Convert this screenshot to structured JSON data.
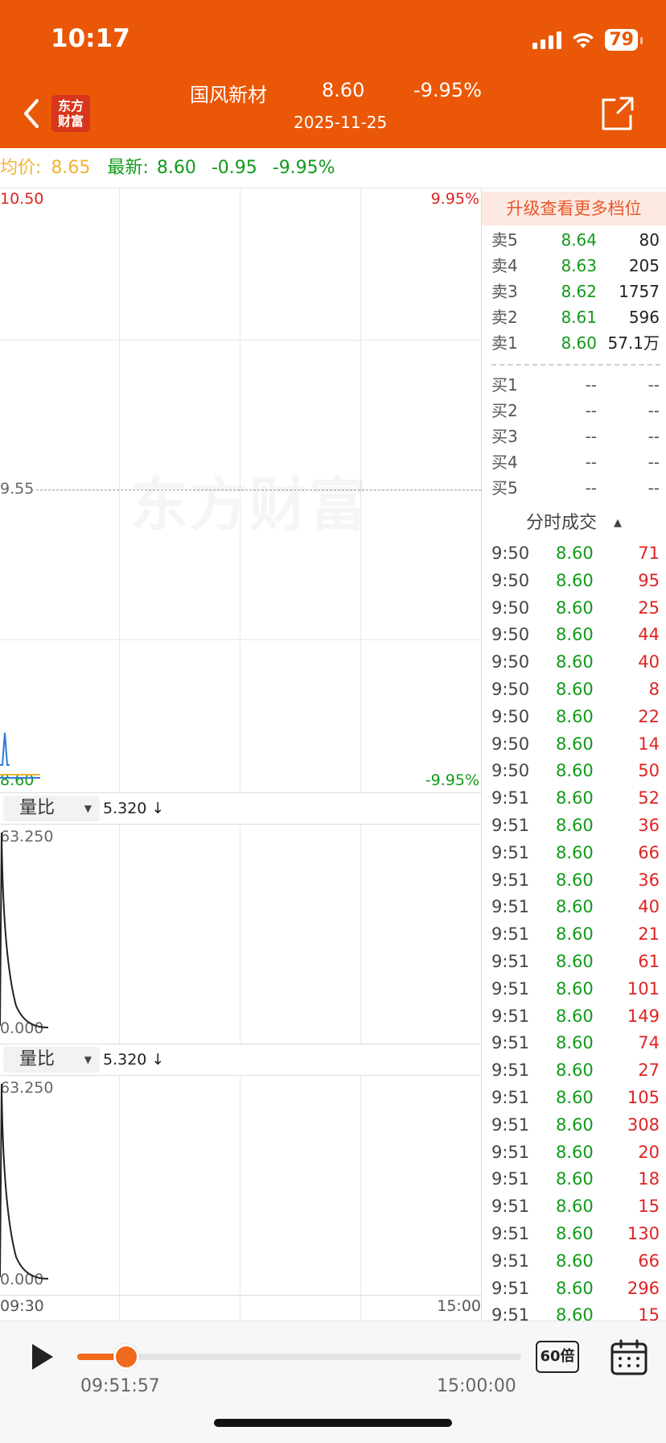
{
  "status_bar": {
    "time": "10:17",
    "battery": "79"
  },
  "header": {
    "logo_line1": "东方",
    "logo_line2": "财富",
    "stock_name": "国风新材",
    "price": "8.60",
    "change_pct": "-9.95%",
    "date": "2025-11-25"
  },
  "info_bar": {
    "avg_label": "均价:",
    "avg_value": "8.65",
    "latest_label": "最新:",
    "latest_value": "8.60",
    "change": "-0.95",
    "change_pct": "-9.95%"
  },
  "price_chart": {
    "top_price": "10.50",
    "top_pct": "9.95%",
    "mid_price": "9.55",
    "bottom_price": "8.60",
    "bottom_pct": "-9.95%",
    "watermark": "东方财富"
  },
  "indicator1": {
    "name": "量比",
    "value": "5.320 ↓",
    "max": "63.250",
    "min": "0.000"
  },
  "indicator2": {
    "name": "量比",
    "value": "5.320 ↓",
    "max": "63.250",
    "min": "0.000"
  },
  "time_axis": {
    "start": "09:30",
    "end": "15:00"
  },
  "order_book": {
    "upgrade_label": "升级查看更多档位",
    "asks": [
      {
        "label": "卖5",
        "price": "8.64",
        "volume": "80"
      },
      {
        "label": "卖4",
        "price": "8.63",
        "volume": "205"
      },
      {
        "label": "卖3",
        "price": "8.62",
        "volume": "1757"
      },
      {
        "label": "卖2",
        "price": "8.61",
        "volume": "596"
      },
      {
        "label": "卖1",
        "price": "8.60",
        "volume": "57.1万"
      }
    ],
    "bids": [
      {
        "label": "买1",
        "price": "--",
        "volume": "--"
      },
      {
        "label": "买2",
        "price": "--",
        "volume": "--"
      },
      {
        "label": "买3",
        "price": "--",
        "volume": "--"
      },
      {
        "label": "买4",
        "price": "--",
        "volume": "--"
      },
      {
        "label": "买5",
        "price": "--",
        "volume": "--"
      }
    ]
  },
  "trades": {
    "title": "分时成交",
    "rows": [
      {
        "time": "9:50",
        "price": "8.60",
        "volume": "71"
      },
      {
        "time": "9:50",
        "price": "8.60",
        "volume": "95"
      },
      {
        "time": "9:50",
        "price": "8.60",
        "volume": "25"
      },
      {
        "time": "9:50",
        "price": "8.60",
        "volume": "44"
      },
      {
        "time": "9:50",
        "price": "8.60",
        "volume": "40"
      },
      {
        "time": "9:50",
        "price": "8.60",
        "volume": "8"
      },
      {
        "time": "9:50",
        "price": "8.60",
        "volume": "22"
      },
      {
        "time": "9:50",
        "price": "8.60",
        "volume": "14"
      },
      {
        "time": "9:50",
        "price": "8.60",
        "volume": "50"
      },
      {
        "time": "9:51",
        "price": "8.60",
        "volume": "52"
      },
      {
        "time": "9:51",
        "price": "8.60",
        "volume": "36"
      },
      {
        "time": "9:51",
        "price": "8.60",
        "volume": "66"
      },
      {
        "time": "9:51",
        "price": "8.60",
        "volume": "36"
      },
      {
        "time": "9:51",
        "price": "8.60",
        "volume": "40"
      },
      {
        "time": "9:51",
        "price": "8.60",
        "volume": "21"
      },
      {
        "time": "9:51",
        "price": "8.60",
        "volume": "61"
      },
      {
        "time": "9:51",
        "price": "8.60",
        "volume": "101"
      },
      {
        "time": "9:51",
        "price": "8.60",
        "volume": "149"
      },
      {
        "time": "9:51",
        "price": "8.60",
        "volume": "74"
      },
      {
        "time": "9:51",
        "price": "8.60",
        "volume": "27"
      },
      {
        "time": "9:51",
        "price": "8.60",
        "volume": "105"
      },
      {
        "time": "9:51",
        "price": "8.60",
        "volume": "308"
      },
      {
        "time": "9:51",
        "price": "8.60",
        "volume": "20"
      },
      {
        "time": "9:51",
        "price": "8.60",
        "volume": "18"
      },
      {
        "time": "9:51",
        "price": "8.60",
        "volume": "15"
      },
      {
        "time": "9:51",
        "price": "8.60",
        "volume": "130"
      },
      {
        "time": "9:51",
        "price": "8.60",
        "volume": "66"
      },
      {
        "time": "9:51",
        "price": "8.60",
        "volume": "296"
      },
      {
        "time": "9:51",
        "price": "8.60",
        "volume": "15"
      }
    ]
  },
  "player": {
    "current_time": "09:51:57",
    "end_time": "15:00:00",
    "progress": 0.11,
    "speed": "60倍"
  },
  "colors": {
    "brand": "#EA5706",
    "down": "#119A1A",
    "up": "#E02222",
    "avg": "#F1B32F"
  }
}
